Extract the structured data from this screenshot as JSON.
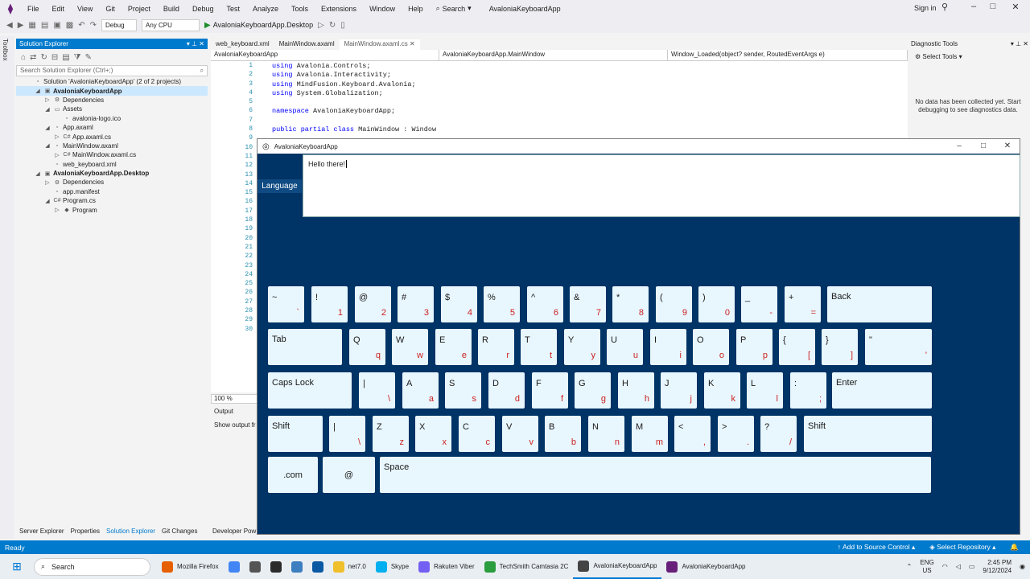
{
  "menubar": {
    "items": [
      "File",
      "Edit",
      "View",
      "Git",
      "Project",
      "Build",
      "Debug",
      "Test",
      "Analyze",
      "Tools",
      "Extensions",
      "Window",
      "Help"
    ],
    "search_label": "Search",
    "solution_name": "AvaloniaKeyboardApp",
    "signin": "Sign in"
  },
  "toolbar": {
    "config": "Debug",
    "platform": "Any CPU",
    "startup": "AvaloniaKeyboardApp.Desktop"
  },
  "toolbox": {
    "label": "Toolbox"
  },
  "solution_explorer": {
    "title": "Solution Explorer",
    "search_placeholder": "Search Solution Explorer (Ctrl+;)",
    "items": [
      {
        "text": "Solution 'AvaloniaKeyboardApp' (2 of 2 projects)",
        "icon": "▫"
      },
      {
        "text": "AvaloniaKeyboardApp",
        "icon": "▣"
      },
      {
        "text": "Dependencies",
        "icon": "⚙"
      },
      {
        "text": "Assets",
        "icon": "▭"
      },
      {
        "text": "avalonia-logo.ico",
        "icon": "▫"
      },
      {
        "text": "App.axaml",
        "icon": "▫"
      },
      {
        "text": "App.axaml.cs",
        "icon": "C#"
      },
      {
        "text": "MainWindow.axaml",
        "icon": "▫"
      },
      {
        "text": "MainWindow.axaml.cs",
        "icon": "C#"
      },
      {
        "text": "web_keyboard.xml",
        "icon": "▫"
      },
      {
        "text": "AvaloniaKeyboardApp.Desktop",
        "icon": "▣"
      },
      {
        "text": "Dependencies",
        "icon": "⚙"
      },
      {
        "text": "app.manifest",
        "icon": "▫"
      },
      {
        "text": "Program.cs",
        "icon": "C#"
      },
      {
        "text": "Program",
        "icon": "◆"
      }
    ]
  },
  "editor": {
    "tabs": [
      "web_keyboard.xml",
      "MainWindow.axaml",
      "MainWindow.axaml.cs"
    ],
    "nav": [
      "AvaloniaKeyboardApp",
      "AvaloniaKeyboardApp.MainWindow",
      "Window_Loaded(object? sender, RoutedEventArgs e)"
    ],
    "line_numbers": [
      "1",
      "2",
      "3",
      "4",
      "5",
      "6",
      "7",
      "8",
      "9",
      "10",
      "11",
      "12",
      "13",
      "14",
      "15",
      "16",
      "17",
      "18",
      "19",
      "20",
      "21",
      "22",
      "23",
      "24",
      "25",
      "26",
      "27",
      "28",
      "29",
      "30"
    ],
    "code": [
      {
        "kw": "using",
        "rest": " Avalonia.Controls;"
      },
      {
        "kw": "using",
        "rest": " Avalonia.Interactivity;"
      },
      {
        "kw": "using",
        "rest": " MindFusion.Keyboard.Avalonia;"
      },
      {
        "kw": "using",
        "rest": " System.Globalization;"
      },
      {
        "kw": "",
        "rest": ""
      },
      {
        "kw": "namespace",
        "rest": " AvaloniaKeyboardApp;"
      },
      {
        "kw": "",
        "rest": ""
      },
      {
        "kw": "public partial class",
        "rest": " MainWindow : Window"
      }
    ],
    "zoom": "100 %"
  },
  "output": {
    "title": "Output",
    "show_label": "Show output fr"
  },
  "diagnostic_tools": {
    "title": "Diagnostic Tools",
    "select_tools": "Select Tools",
    "message": "No data has been collected yet. Start debugging to see diagnostics data."
  },
  "bottom_tabs": [
    "Server Explorer",
    "Properties",
    "Solution Explorer",
    "Git Changes"
  ],
  "developer_power": "Developer Pow",
  "status": {
    "ready": "Ready",
    "source_control": "Add to Source Control",
    "repo": "Select Repository"
  },
  "taskbar": {
    "search": "Search",
    "apps": [
      {
        "label": "Mozilla Firefox",
        "color": "#e66000"
      },
      {
        "label": "",
        "color": "#4285f4"
      },
      {
        "label": "",
        "color": "#555555"
      },
      {
        "label": "",
        "color": "#2b2b2b"
      },
      {
        "label": "",
        "color": "#3c7ebf"
      },
      {
        "label": "",
        "color": "#0c59a4"
      },
      {
        "label": "net7.0",
        "color": "#f0c02c"
      },
      {
        "label": "Skype",
        "color": "#00aff0"
      },
      {
        "label": "Rakuten Viber",
        "color": "#7360f2"
      },
      {
        "label": "TechSmith Camtasia 2C",
        "color": "#2a9d3f"
      },
      {
        "label": "AvaloniaKeyboardApp",
        "color": "#444444"
      },
      {
        "label": "AvaloniaKeyboardApp",
        "color": "#68217a"
      }
    ],
    "lang": "ENG",
    "region": "US",
    "time": "2:45 PM",
    "date": "9/12/2024"
  },
  "ava_window": {
    "title": "AvaloniaKeyboardApp",
    "language_btn": "Language",
    "text": "Hello there!",
    "rows": [
      [
        {
          "t": "~",
          "b": "`"
        },
        {
          "t": "!",
          "b": "1"
        },
        {
          "t": "@",
          "b": "2"
        },
        {
          "t": "#",
          "b": "3"
        },
        {
          "t": "$",
          "b": "4"
        },
        {
          "t": "%",
          "b": "5"
        },
        {
          "t": "^",
          "b": "6"
        },
        {
          "t": "&",
          "b": "7"
        },
        {
          "t": "*",
          "b": "8"
        },
        {
          "t": "(",
          "b": "9"
        },
        {
          "t": ")",
          "b": "0"
        },
        {
          "t": "_",
          "b": "-"
        },
        {
          "t": "+",
          "b": "="
        },
        {
          "l": "Back"
        }
      ],
      [
        {
          "l": "Tab"
        },
        {
          "t": "Q",
          "b": "q"
        },
        {
          "t": "W",
          "b": "w"
        },
        {
          "t": "E",
          "b": "e"
        },
        {
          "t": "R",
          "b": "r"
        },
        {
          "t": "T",
          "b": "t"
        },
        {
          "t": "Y",
          "b": "y"
        },
        {
          "t": "U",
          "b": "u"
        },
        {
          "t": "I",
          "b": "i"
        },
        {
          "t": "O",
          "b": "o"
        },
        {
          "t": "P",
          "b": "p"
        },
        {
          "t": "{",
          "b": "["
        },
        {
          "t": "}",
          "b": "]"
        },
        {
          "t": "\"",
          "b": "'"
        }
      ],
      [
        {
          "l": "Caps Lock"
        },
        {
          "t": "|",
          "b": "\\"
        },
        {
          "t": "A",
          "b": "a"
        },
        {
          "t": "S",
          "b": "s"
        },
        {
          "t": "D",
          "b": "d"
        },
        {
          "t": "F",
          "b": "f"
        },
        {
          "t": "G",
          "b": "g"
        },
        {
          "t": "H",
          "b": "h"
        },
        {
          "t": "J",
          "b": "j"
        },
        {
          "t": "K",
          "b": "k"
        },
        {
          "t": "L",
          "b": "l"
        },
        {
          "t": ":",
          "b": ";"
        },
        {
          "l": "Enter"
        }
      ],
      [
        {
          "l": "Shift"
        },
        {
          "t": "|",
          "b": "\\"
        },
        {
          "t": "Z",
          "b": "z"
        },
        {
          "t": "X",
          "b": "x"
        },
        {
          "t": "C",
          "b": "c"
        },
        {
          "t": "V",
          "b": "v"
        },
        {
          "t": "B",
          "b": "b"
        },
        {
          "t": "N",
          "b": "n"
        },
        {
          "t": "M",
          "b": "m"
        },
        {
          "t": "<",
          "b": ","
        },
        {
          "t": ">",
          "b": "."
        },
        {
          "t": "?",
          "b": "/"
        },
        {
          "l": "Shift"
        }
      ],
      [
        {
          "c": ".com"
        },
        {
          "c": "@"
        },
        {
          "l": "Space"
        }
      ]
    ]
  }
}
